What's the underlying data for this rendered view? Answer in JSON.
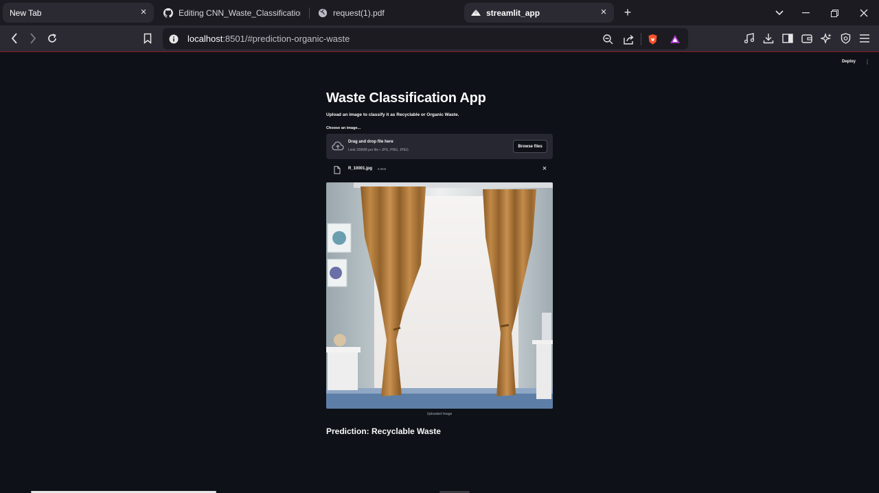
{
  "browser": {
    "tabs": [
      {
        "label": "New Tab",
        "favicon": "none"
      },
      {
        "label": "Editing CNN_Waste_Classification/R",
        "favicon": "github-icon"
      },
      {
        "label": "request(1).pdf",
        "favicon": "globe-icon"
      },
      {
        "label": "streamlit_app",
        "favicon": "streamlit-icon"
      }
    ],
    "url_host": "localhost",
    "url_rest": ":8501/#prediction-organic-waste"
  },
  "app": {
    "deploy_label": "Deploy",
    "title": "Waste Classification App",
    "subtitle": "Upload an image to classify it as Recyclable or Organic Waste.",
    "uploader_label": "Choose an image...",
    "dropzone_title": "Drag and drop file here",
    "dropzone_limit": "Limit 200MB per file • JPG, PNG, JPEG",
    "browse_label": "Browse files",
    "file_name": "R_10001.jpg",
    "file_size": "8.6KB",
    "image_caption": "Uploaded Image",
    "prediction": "Prediction: Recyclable Waste"
  },
  "colors": {
    "page_bg": "#0e1117",
    "dropzone_bg": "#262730",
    "text": "#fafafa",
    "muted": "#a3a8b4",
    "accent_line": "#8a1e1e"
  }
}
